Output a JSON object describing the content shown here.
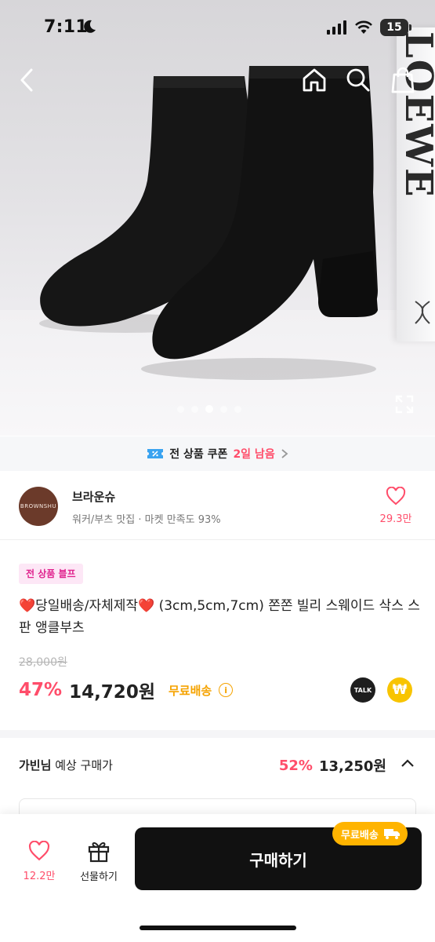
{
  "status_bar": {
    "time": "7:11",
    "battery": "15"
  },
  "hero": {
    "box_text": "LOEWE",
    "carousel_count": 5,
    "carousel_active": 3
  },
  "coupon": {
    "label": "전 상품 쿠폰",
    "remaining": "2일 남음"
  },
  "seller": {
    "name": "브라운슈",
    "logo_text": "BROWNSHU",
    "description": "워커/부츠 맛집 · 마켓 만족도 93%",
    "likes": "29.3만"
  },
  "product": {
    "tag": "전 상품 블프",
    "title": "❤️당일배송/자체제작❤️ (3cm,5cm,7cm) 쫀쫀 빌리 스웨이드 삭스 스판 앵클부츠",
    "original_price": "28,000원",
    "discount": "47%",
    "price": "14,720원",
    "free_shipping": "무료배송",
    "talk_label": "TALK",
    "pay_label": "₩"
  },
  "expected": {
    "user": "가빈님",
    "label": "예상 구매가",
    "discount": "52%",
    "price": "13,250원"
  },
  "bottom_bar": {
    "likes": "12.2만",
    "gift_label": "선물하기",
    "buy_label": "구매하기",
    "shipping_badge": "무료배송"
  },
  "colors": {
    "accent": "#ff4d6a",
    "shipping": "#f5a300",
    "badge": "#ffb400",
    "buy": "#111111"
  }
}
